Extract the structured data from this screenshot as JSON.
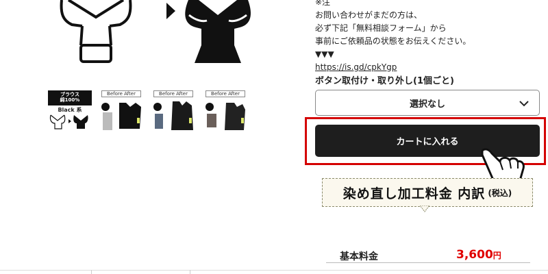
{
  "notice": {
    "lines": [
      "※注",
      "お問い合わせがまだの方は、",
      "必ず下記「無料相談フォーム」から",
      "事前にご依頼品の状態をお伝えください。",
      "▼▼▼"
    ],
    "link": "https://is.gd/cpkYgp"
  },
  "thumbnails": {
    "blouse_tag": "ブラウス\n綿100%",
    "blouse_sub": "Black 系",
    "before_after": "Before After"
  },
  "option": {
    "label": "ボタン取付け・取り外し(1個ごと)",
    "selected": "選択なし"
  },
  "cart": {
    "label": "カートに入れる"
  },
  "price_banner": {
    "title": "染め直し加工料金 内訳",
    "tax": "(税込)"
  },
  "price_rows": [
    {
      "label": "基本料金",
      "value": "3,600",
      "unit": "円"
    }
  ],
  "colors": {
    "highlight": "#d40000",
    "button": "#1e1e1e",
    "price": "#e00000"
  }
}
